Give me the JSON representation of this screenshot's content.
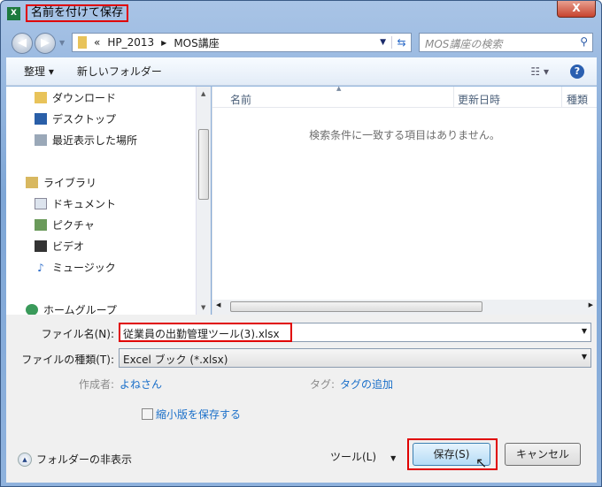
{
  "window": {
    "title": "名前を付けて保存",
    "close_label": "X",
    "app_icon": "X"
  },
  "address": {
    "overflow": "«",
    "segments": [
      "HP_2013",
      "MOS講座"
    ],
    "search_placeholder": "MOS講座の検索"
  },
  "toolbar": {
    "organize": "整理",
    "new_folder": "新しいフォルダー"
  },
  "sidebar": {
    "items": [
      {
        "label": "ダウンロード",
        "icon": "downloads-icon"
      },
      {
        "label": "デスクトップ",
        "icon": "desktop-icon"
      },
      {
        "label": "最近表示した場所",
        "icon": "recent-places-icon"
      },
      {
        "label": "ライブラリ",
        "icon": "library-icon"
      },
      {
        "label": "ドキュメント",
        "icon": "documents-icon"
      },
      {
        "label": "ピクチャ",
        "icon": "pictures-icon"
      },
      {
        "label": "ビデオ",
        "icon": "videos-icon"
      },
      {
        "label": "ミュージック",
        "icon": "music-icon"
      },
      {
        "label": "ホームグループ",
        "icon": "homegroup-icon"
      }
    ]
  },
  "filelist": {
    "columns": [
      "名前",
      "更新日時",
      "種類"
    ],
    "empty_message": "検索条件に一致する項目はありません。"
  },
  "form": {
    "filename_label": "ファイル名(N):",
    "filename_value": "従業員の出勤管理ツール(3).xlsx",
    "filetype_label": "ファイルの種類(T):",
    "filetype_value": "Excel ブック (*.xlsx)",
    "author_label": "作成者:",
    "author_value": "よねさん",
    "tags_label": "タグ:",
    "tags_value": "タグの追加",
    "thumbnail_label": "縮小版を保存する",
    "hide_folders": "フォルダーの非表示",
    "tools": "ツール(L)",
    "save": "保存(S)",
    "cancel": "キャンセル"
  },
  "colors": {
    "highlight": "#e00000",
    "link": "#1a6fc9"
  }
}
